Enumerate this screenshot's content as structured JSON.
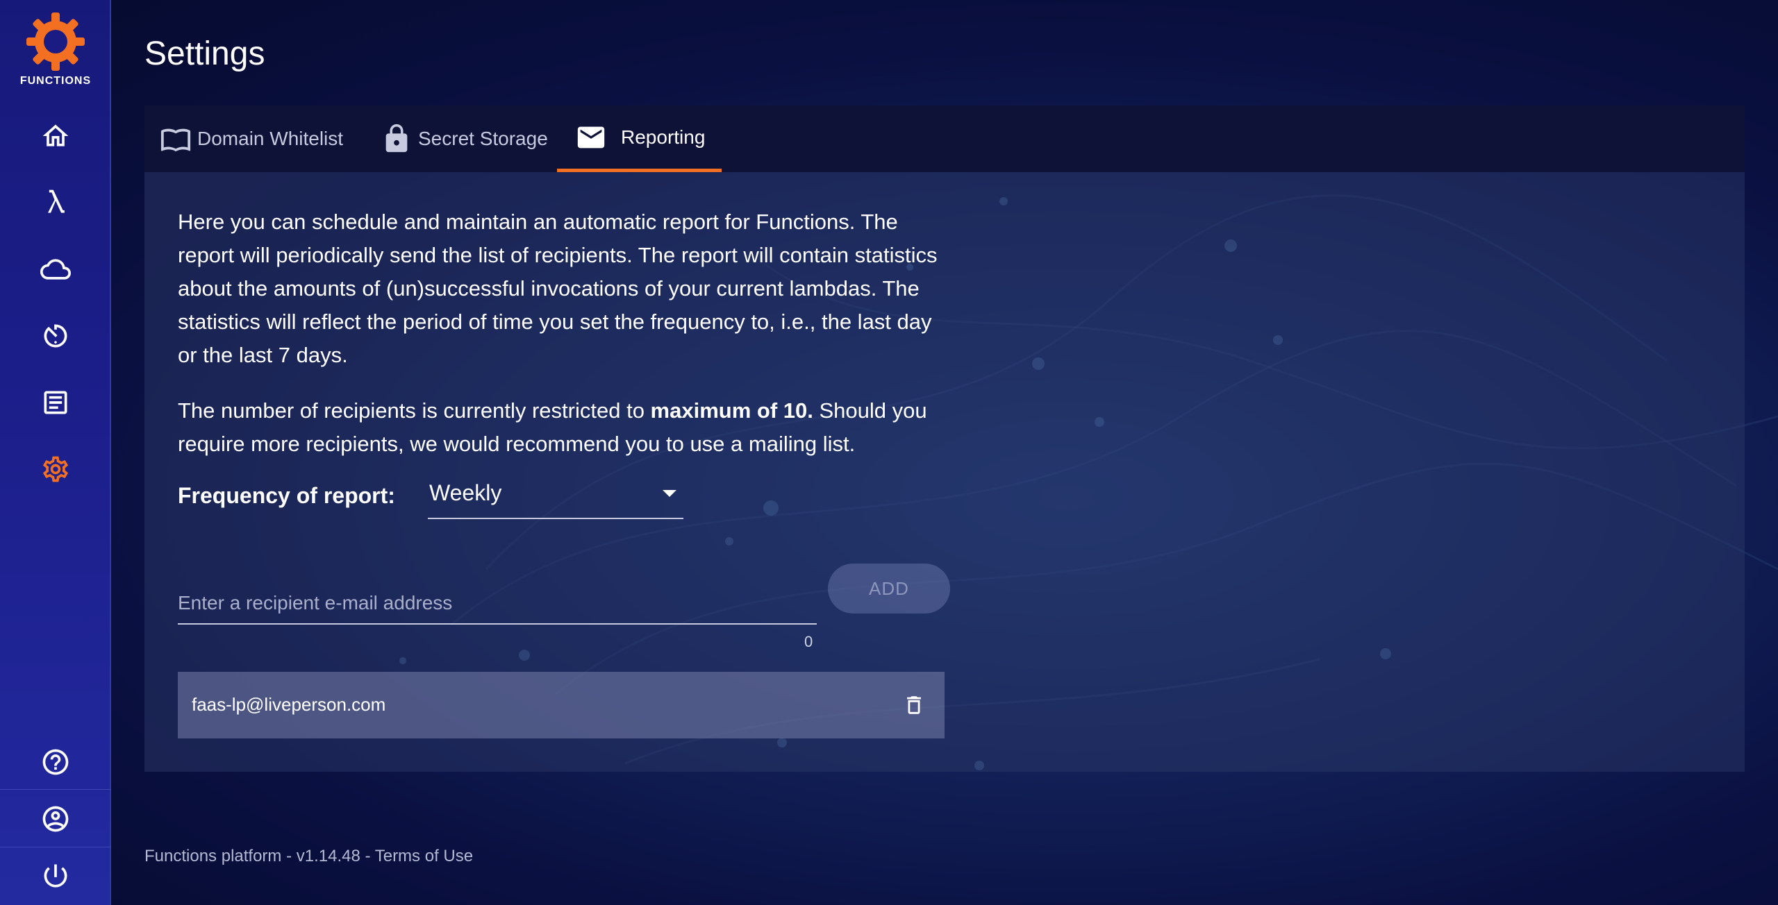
{
  "app": {
    "logo_text": "FUNCTIONS",
    "accent_color": "#f36f21"
  },
  "sidebar": {
    "items": [
      {
        "icon": "home-icon",
        "active": false
      },
      {
        "icon": "lambda-icon",
        "active": false
      },
      {
        "icon": "cloud-icon",
        "active": false
      },
      {
        "icon": "timer-icon",
        "active": false
      },
      {
        "icon": "logs-icon",
        "active": false
      },
      {
        "icon": "gear-icon",
        "active": true
      }
    ],
    "bottom_items": [
      {
        "icon": "help-icon"
      },
      {
        "icon": "account-icon"
      },
      {
        "icon": "power-icon"
      }
    ]
  },
  "page": {
    "title": "Settings"
  },
  "tabs": [
    {
      "label": "Domain Whitelist",
      "icon": "book-icon",
      "active": false
    },
    {
      "label": "Secret Storage",
      "icon": "lock-icon",
      "active": false
    },
    {
      "label": "Reporting",
      "icon": "mail-icon",
      "active": true
    }
  ],
  "reporting": {
    "description": "Here you can schedule and maintain an automatic report for Functions. The report will periodically send the list of recipients. The report will contain statistics about the amounts of (un)successful invocations of your current lambdas. The statistics will reflect the period of time you set the frequency to, i.e., the last day or the last 7 days.",
    "limit_prefix": "The number of recipients is currently restricted to ",
    "limit_bold": "maximum of 10.",
    "limit_suffix": " Should you require more recipients, we would recommend you to use a mailing list.",
    "frequency_label": "Frequency of report:",
    "frequency_value": "Weekly",
    "email_placeholder": "Enter a recipient e-mail address",
    "email_value": "",
    "char_count": "0",
    "add_label": "ADD",
    "recipients": [
      "faas-lp@liveperson.com"
    ]
  },
  "footer": {
    "version_text": "Functions platform - v1.14.48 - ",
    "terms_label": "Terms of Use"
  }
}
